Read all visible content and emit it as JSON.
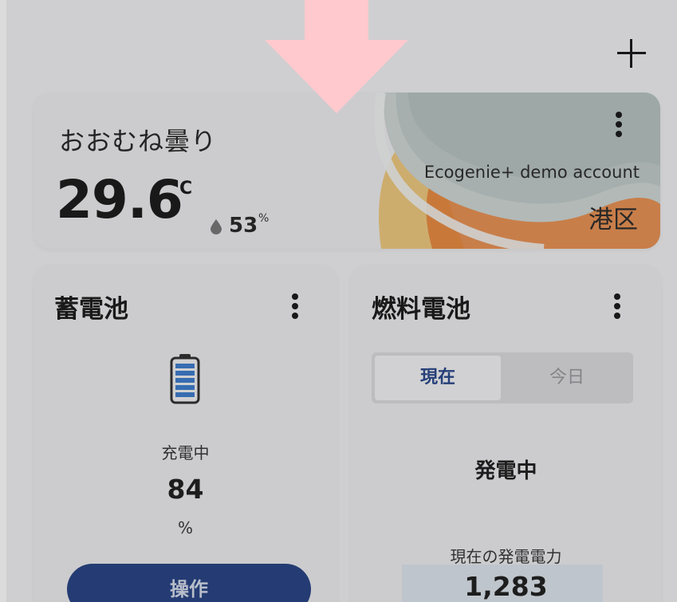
{
  "header": {
    "add_icon": "plus-icon"
  },
  "weather": {
    "condition": "おおむね曇り",
    "temperature": "29.6",
    "temperature_unit": "°C",
    "humidity_icon": "water-drop-icon",
    "humidity": "53",
    "humidity_unit": "%",
    "account": "Ecogenie+ demo account",
    "location": "港区",
    "menu_icon": "more-vertical-icon",
    "colors": {
      "orange": "#e8823a",
      "yellow": "#efc064",
      "cloud": "#b9c4c2"
    }
  },
  "battery_card": {
    "title": "蓄電池",
    "menu_icon": "more-vertical-icon",
    "icon": "battery-icon",
    "status": "充電中",
    "level": "84",
    "level_unit": "%",
    "level_fraction": 0.84,
    "operate_label": "操作",
    "accent_color": "#2a4686"
  },
  "fuel_cell_card": {
    "title": "燃料電池",
    "menu_icon": "more-vertical-icon",
    "tabs": [
      {
        "label": "現在",
        "selected": true
      },
      {
        "label": "今日",
        "selected": false
      }
    ],
    "status": "発電中",
    "power_label": "現在の発電電力",
    "power_value": "1,283"
  },
  "overlay": {
    "hint_icon": "arrow-down-icon",
    "hint_color": "#ffc9cd"
  }
}
